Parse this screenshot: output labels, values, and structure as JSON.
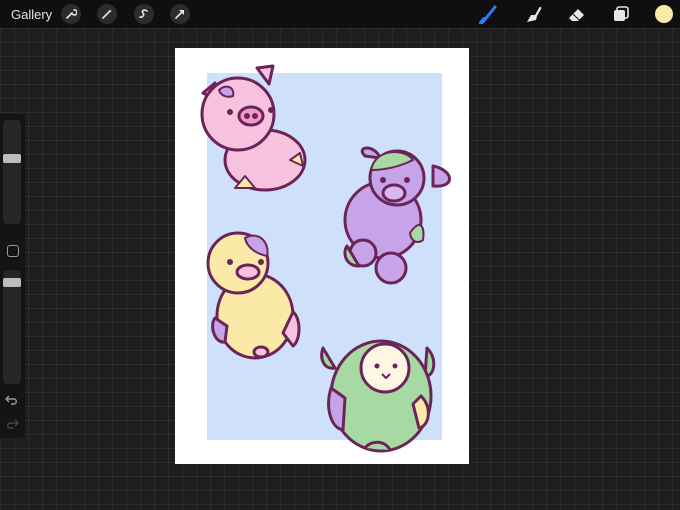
{
  "topbar": {
    "gallery_label": "Gallery",
    "left_tools": [
      "wrench-icon",
      "magic-wand-icon",
      "selection-icon",
      "transform-arrow-icon"
    ],
    "right_tools": [
      "brush-icon",
      "smudge-icon",
      "eraser-icon",
      "layers-icon"
    ],
    "active_tool": "brush-icon",
    "active_tool_color": "#2f7cf6",
    "current_color": "#fbe9a8"
  },
  "sidebar": {
    "size_slider_level": 0.27,
    "opacity_slider_level": 0.0,
    "controls": [
      "modify-button",
      "undo-icon",
      "redo-icon"
    ]
  },
  "artwork": {
    "background_color": "#cfe0fb",
    "characters": [
      "pink-pig-plush",
      "purple-green-cow-plush",
      "yellow-duck-plush",
      "green-lamb-plush"
    ]
  }
}
